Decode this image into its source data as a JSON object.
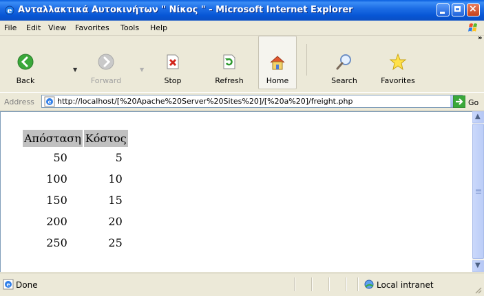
{
  "window": {
    "title": "Ανταλλακτικά Αυτοκινήτων \" Νίκος \" - Microsoft Internet Explorer",
    "controls": [
      "minimize",
      "maximize",
      "close"
    ]
  },
  "menu": {
    "items": [
      "File",
      "Edit",
      "View",
      "Favorites",
      "Tools",
      "Help"
    ]
  },
  "toolbar": {
    "back": "Back",
    "forward": "Forward",
    "stop": "Stop",
    "refresh": "Refresh",
    "home": "Home",
    "search": "Search",
    "favorites": "Favorites"
  },
  "address": {
    "label": "Address",
    "url": "http://localhost/[%20Apache%20Server%20Sites%20]/[%20a%20]/freight.php",
    "go": "Go"
  },
  "table": {
    "headers": [
      "Απόσταση",
      "Κόστος"
    ],
    "rows": [
      [
        "50",
        "5"
      ],
      [
        "100",
        "10"
      ],
      [
        "150",
        "15"
      ],
      [
        "200",
        "20"
      ],
      [
        "250",
        "25"
      ]
    ]
  },
  "status": {
    "text": "Done",
    "zone": "Local intranet"
  },
  "colors": {
    "titlebar": "#0a5fe0",
    "table_header_bg": "#c0c0c0",
    "chrome_bg": "#ece9d8"
  },
  "icons": [
    "ie-icon",
    "windows-flag-icon",
    "back-icon",
    "forward-icon",
    "stop-icon",
    "refresh-icon",
    "home-icon",
    "search-icon",
    "favorites-star-icon",
    "go-arrow-icon",
    "intranet-icon"
  ]
}
